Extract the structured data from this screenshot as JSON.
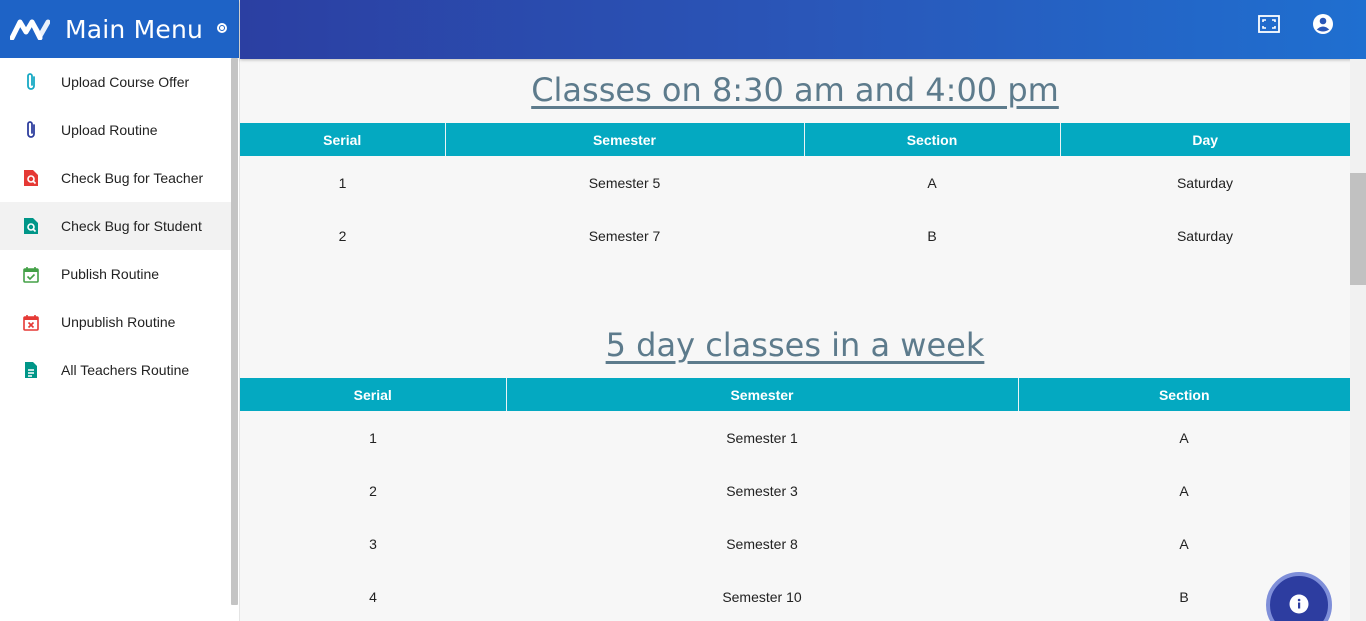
{
  "sidebar": {
    "brand_title": "Main Menu",
    "items": [
      {
        "label": "Upload Course Offer",
        "icon": "paperclip-icon",
        "color": "#17a9c4"
      },
      {
        "label": "Upload Routine",
        "icon": "paperclip-icon",
        "color": "#2f3f9e"
      },
      {
        "label": "Check Bug for Teacher",
        "icon": "file-search-icon",
        "color": "#e53935"
      },
      {
        "label": "Check Bug for Student",
        "icon": "file-search-icon",
        "color": "#009688"
      },
      {
        "label": "Publish Routine",
        "icon": "calendar-check-icon",
        "color": "#43a047"
      },
      {
        "label": "Unpublish Routine",
        "icon": "calendar-remove-icon",
        "color": "#e53935"
      },
      {
        "label": "All Teachers Routine",
        "icon": "document-icon",
        "color": "#009688"
      }
    ],
    "active_index": 3
  },
  "header": {
    "icons": [
      "fullscreen-icon",
      "account-circle-icon"
    ]
  },
  "colors": {
    "accent": "#04a9c1",
    "header": "#2a56b8",
    "title": "#5d7b8c"
  },
  "section1": {
    "title": "Classes on 8:30 am and 4:00 pm",
    "columns": [
      "Serial",
      "Semester",
      "Section",
      "Day"
    ],
    "rows": [
      [
        "1",
        "Semester 5",
        "A",
        "Saturday"
      ],
      [
        "2",
        "Semester 7",
        "B",
        "Saturday"
      ]
    ]
  },
  "section2": {
    "title": "5 day classes in a week",
    "columns": [
      "Serial",
      "Semester",
      "Section"
    ],
    "rows": [
      [
        "1",
        "Semester 1",
        "A"
      ],
      [
        "2",
        "Semester 3",
        "A"
      ],
      [
        "3",
        "Semester 8",
        "A"
      ],
      [
        "4",
        "Semester 10",
        "B"
      ]
    ]
  },
  "fab": {
    "icon": "info-icon"
  }
}
